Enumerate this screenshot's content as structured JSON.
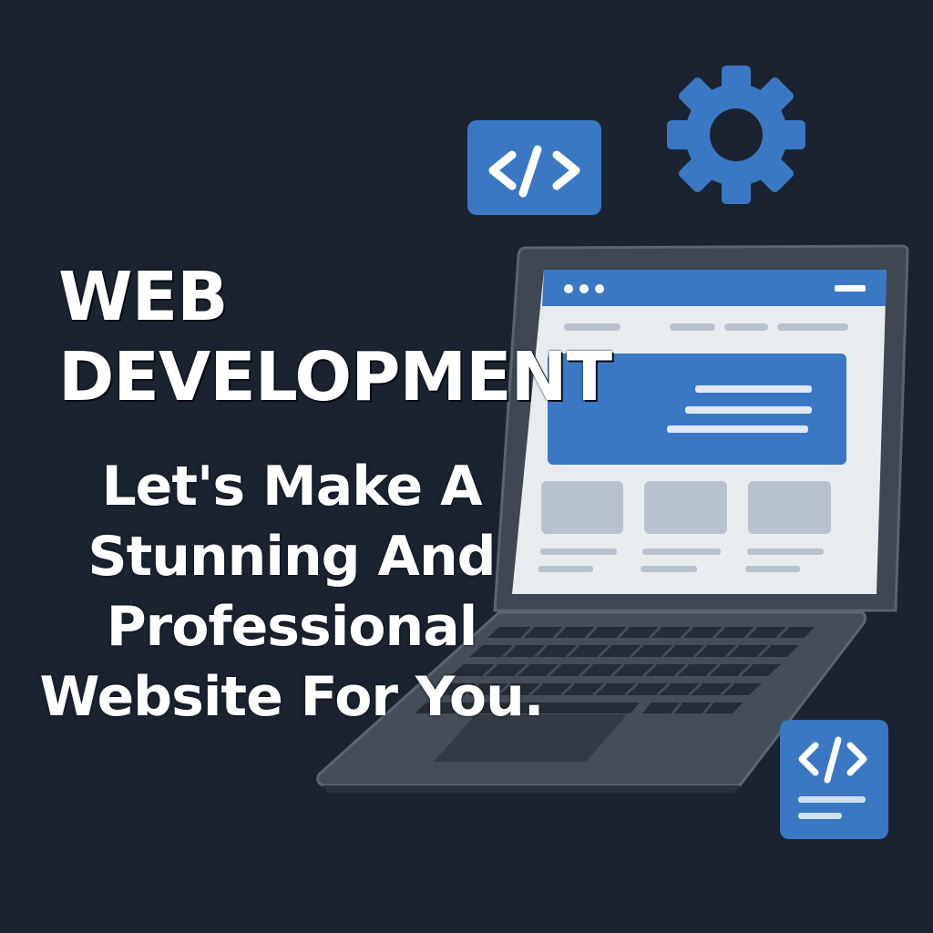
{
  "headline": {
    "line1": "WEB",
    "line2": "DEVELOPMENT"
  },
  "tagline": {
    "lines": [
      "Let's Make A",
      "Stunning And",
      "Professional",
      "Website For You."
    ]
  },
  "icons": {
    "code_badge_top": "code-brackets-icon",
    "gear": "gear-icon",
    "code_document": "code-document-icon",
    "laptop": "laptop-icon"
  },
  "colors": {
    "background": "#1b2331",
    "accent_blue": "#3a78c3",
    "text": "#ffffff",
    "laptop_body": "#454d58",
    "screen": "#e9ecef"
  }
}
